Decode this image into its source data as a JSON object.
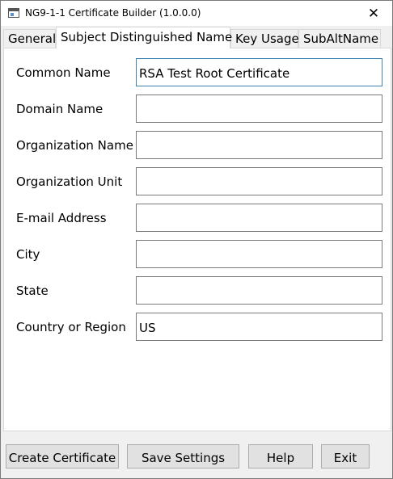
{
  "window": {
    "title": "NG9-1-1 Certificate Builder (1.0.0.0)",
    "close_glyph": "✕"
  },
  "tabs": [
    {
      "label": "General",
      "active": false
    },
    {
      "label": "Subject Distinguished Name",
      "active": true
    },
    {
      "label": "Key Usage",
      "active": false
    },
    {
      "label": "SubAltName",
      "active": false
    }
  ],
  "fields": [
    {
      "label": "Common Name",
      "value": "RSA Test Root Certificate"
    },
    {
      "label": "Domain Name",
      "value": ""
    },
    {
      "label": "Organization Name",
      "value": ""
    },
    {
      "label": "Organization Unit",
      "value": ""
    },
    {
      "label": "E-mail Address",
      "value": ""
    },
    {
      "label": "City",
      "value": ""
    },
    {
      "label": "State",
      "value": ""
    },
    {
      "label": "Country or Region",
      "value": "US"
    }
  ],
  "buttons": {
    "create": "Create Certificate",
    "save": "Save Settings",
    "help": "Help",
    "exit": "Exit"
  }
}
